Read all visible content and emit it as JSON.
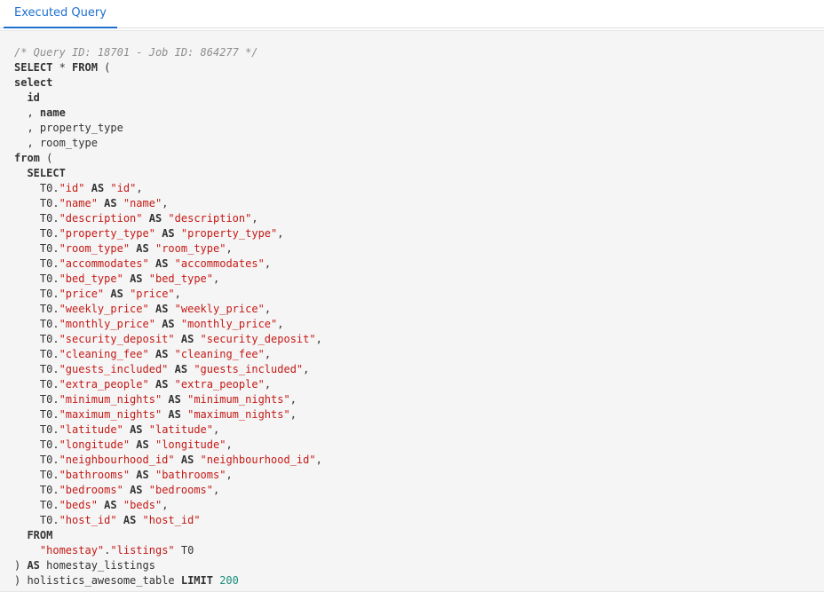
{
  "tab": {
    "label": "Executed Query"
  },
  "code": {
    "lines": [
      [
        {
          "t": "c",
          "v": "/* Query ID: 18701 - Job ID: 864277 */"
        }
      ],
      [
        {
          "t": "k",
          "v": "SELECT"
        },
        {
          "t": "p",
          "v": " * "
        },
        {
          "t": "k",
          "v": "FROM"
        },
        {
          "t": "p",
          "v": " ("
        }
      ],
      [
        {
          "t": "k",
          "v": "select"
        }
      ],
      [
        {
          "t": "p",
          "v": "  "
        },
        {
          "t": "k",
          "v": "id"
        }
      ],
      [
        {
          "t": "p",
          "v": "  , "
        },
        {
          "t": "k",
          "v": "name"
        }
      ],
      [
        {
          "t": "p",
          "v": "  , property_type"
        }
      ],
      [
        {
          "t": "p",
          "v": "  , room_type"
        }
      ],
      [
        {
          "t": "k",
          "v": "from"
        },
        {
          "t": "p",
          "v": " ("
        }
      ],
      [
        {
          "t": "p",
          "v": "  "
        },
        {
          "t": "k",
          "v": "SELECT"
        }
      ],
      [
        {
          "t": "p",
          "v": "    T0."
        },
        {
          "t": "s",
          "v": "\"id\""
        },
        {
          "t": "p",
          "v": " "
        },
        {
          "t": "k",
          "v": "AS"
        },
        {
          "t": "p",
          "v": " "
        },
        {
          "t": "s",
          "v": "\"id\""
        },
        {
          "t": "p",
          "v": ","
        }
      ],
      [
        {
          "t": "p",
          "v": "    T0."
        },
        {
          "t": "s",
          "v": "\"name\""
        },
        {
          "t": "p",
          "v": " "
        },
        {
          "t": "k",
          "v": "AS"
        },
        {
          "t": "p",
          "v": " "
        },
        {
          "t": "s",
          "v": "\"name\""
        },
        {
          "t": "p",
          "v": ","
        }
      ],
      [
        {
          "t": "p",
          "v": "    T0."
        },
        {
          "t": "s",
          "v": "\"description\""
        },
        {
          "t": "p",
          "v": " "
        },
        {
          "t": "k",
          "v": "AS"
        },
        {
          "t": "p",
          "v": " "
        },
        {
          "t": "s",
          "v": "\"description\""
        },
        {
          "t": "p",
          "v": ","
        }
      ],
      [
        {
          "t": "p",
          "v": "    T0."
        },
        {
          "t": "s",
          "v": "\"property_type\""
        },
        {
          "t": "p",
          "v": " "
        },
        {
          "t": "k",
          "v": "AS"
        },
        {
          "t": "p",
          "v": " "
        },
        {
          "t": "s",
          "v": "\"property_type\""
        },
        {
          "t": "p",
          "v": ","
        }
      ],
      [
        {
          "t": "p",
          "v": "    T0."
        },
        {
          "t": "s",
          "v": "\"room_type\""
        },
        {
          "t": "p",
          "v": " "
        },
        {
          "t": "k",
          "v": "AS"
        },
        {
          "t": "p",
          "v": " "
        },
        {
          "t": "s",
          "v": "\"room_type\""
        },
        {
          "t": "p",
          "v": ","
        }
      ],
      [
        {
          "t": "p",
          "v": "    T0."
        },
        {
          "t": "s",
          "v": "\"accommodates\""
        },
        {
          "t": "p",
          "v": " "
        },
        {
          "t": "k",
          "v": "AS"
        },
        {
          "t": "p",
          "v": " "
        },
        {
          "t": "s",
          "v": "\"accommodates\""
        },
        {
          "t": "p",
          "v": ","
        }
      ],
      [
        {
          "t": "p",
          "v": "    T0."
        },
        {
          "t": "s",
          "v": "\"bed_type\""
        },
        {
          "t": "p",
          "v": " "
        },
        {
          "t": "k",
          "v": "AS"
        },
        {
          "t": "p",
          "v": " "
        },
        {
          "t": "s",
          "v": "\"bed_type\""
        },
        {
          "t": "p",
          "v": ","
        }
      ],
      [
        {
          "t": "p",
          "v": "    T0."
        },
        {
          "t": "s",
          "v": "\"price\""
        },
        {
          "t": "p",
          "v": " "
        },
        {
          "t": "k",
          "v": "AS"
        },
        {
          "t": "p",
          "v": " "
        },
        {
          "t": "s",
          "v": "\"price\""
        },
        {
          "t": "p",
          "v": ","
        }
      ],
      [
        {
          "t": "p",
          "v": "    T0."
        },
        {
          "t": "s",
          "v": "\"weekly_price\""
        },
        {
          "t": "p",
          "v": " "
        },
        {
          "t": "k",
          "v": "AS"
        },
        {
          "t": "p",
          "v": " "
        },
        {
          "t": "s",
          "v": "\"weekly_price\""
        },
        {
          "t": "p",
          "v": ","
        }
      ],
      [
        {
          "t": "p",
          "v": "    T0."
        },
        {
          "t": "s",
          "v": "\"monthly_price\""
        },
        {
          "t": "p",
          "v": " "
        },
        {
          "t": "k",
          "v": "AS"
        },
        {
          "t": "p",
          "v": " "
        },
        {
          "t": "s",
          "v": "\"monthly_price\""
        },
        {
          "t": "p",
          "v": ","
        }
      ],
      [
        {
          "t": "p",
          "v": "    T0."
        },
        {
          "t": "s",
          "v": "\"security_deposit\""
        },
        {
          "t": "p",
          "v": " "
        },
        {
          "t": "k",
          "v": "AS"
        },
        {
          "t": "p",
          "v": " "
        },
        {
          "t": "s",
          "v": "\"security_deposit\""
        },
        {
          "t": "p",
          "v": ","
        }
      ],
      [
        {
          "t": "p",
          "v": "    T0."
        },
        {
          "t": "s",
          "v": "\"cleaning_fee\""
        },
        {
          "t": "p",
          "v": " "
        },
        {
          "t": "k",
          "v": "AS"
        },
        {
          "t": "p",
          "v": " "
        },
        {
          "t": "s",
          "v": "\"cleaning_fee\""
        },
        {
          "t": "p",
          "v": ","
        }
      ],
      [
        {
          "t": "p",
          "v": "    T0."
        },
        {
          "t": "s",
          "v": "\"guests_included\""
        },
        {
          "t": "p",
          "v": " "
        },
        {
          "t": "k",
          "v": "AS"
        },
        {
          "t": "p",
          "v": " "
        },
        {
          "t": "s",
          "v": "\"guests_included\""
        },
        {
          "t": "p",
          "v": ","
        }
      ],
      [
        {
          "t": "p",
          "v": "    T0."
        },
        {
          "t": "s",
          "v": "\"extra_people\""
        },
        {
          "t": "p",
          "v": " "
        },
        {
          "t": "k",
          "v": "AS"
        },
        {
          "t": "p",
          "v": " "
        },
        {
          "t": "s",
          "v": "\"extra_people\""
        },
        {
          "t": "p",
          "v": ","
        }
      ],
      [
        {
          "t": "p",
          "v": "    T0."
        },
        {
          "t": "s",
          "v": "\"minimum_nights\""
        },
        {
          "t": "p",
          "v": " "
        },
        {
          "t": "k",
          "v": "AS"
        },
        {
          "t": "p",
          "v": " "
        },
        {
          "t": "s",
          "v": "\"minimum_nights\""
        },
        {
          "t": "p",
          "v": ","
        }
      ],
      [
        {
          "t": "p",
          "v": "    T0."
        },
        {
          "t": "s",
          "v": "\"maximum_nights\""
        },
        {
          "t": "p",
          "v": " "
        },
        {
          "t": "k",
          "v": "AS"
        },
        {
          "t": "p",
          "v": " "
        },
        {
          "t": "s",
          "v": "\"maximum_nights\""
        },
        {
          "t": "p",
          "v": ","
        }
      ],
      [
        {
          "t": "p",
          "v": "    T0."
        },
        {
          "t": "s",
          "v": "\"latitude\""
        },
        {
          "t": "p",
          "v": " "
        },
        {
          "t": "k",
          "v": "AS"
        },
        {
          "t": "p",
          "v": " "
        },
        {
          "t": "s",
          "v": "\"latitude\""
        },
        {
          "t": "p",
          "v": ","
        }
      ],
      [
        {
          "t": "p",
          "v": "    T0."
        },
        {
          "t": "s",
          "v": "\"longitude\""
        },
        {
          "t": "p",
          "v": " "
        },
        {
          "t": "k",
          "v": "AS"
        },
        {
          "t": "p",
          "v": " "
        },
        {
          "t": "s",
          "v": "\"longitude\""
        },
        {
          "t": "p",
          "v": ","
        }
      ],
      [
        {
          "t": "p",
          "v": "    T0."
        },
        {
          "t": "s",
          "v": "\"neighbourhood_id\""
        },
        {
          "t": "p",
          "v": " "
        },
        {
          "t": "k",
          "v": "AS"
        },
        {
          "t": "p",
          "v": " "
        },
        {
          "t": "s",
          "v": "\"neighbourhood_id\""
        },
        {
          "t": "p",
          "v": ","
        }
      ],
      [
        {
          "t": "p",
          "v": "    T0."
        },
        {
          "t": "s",
          "v": "\"bathrooms\""
        },
        {
          "t": "p",
          "v": " "
        },
        {
          "t": "k",
          "v": "AS"
        },
        {
          "t": "p",
          "v": " "
        },
        {
          "t": "s",
          "v": "\"bathrooms\""
        },
        {
          "t": "p",
          "v": ","
        }
      ],
      [
        {
          "t": "p",
          "v": "    T0."
        },
        {
          "t": "s",
          "v": "\"bedrooms\""
        },
        {
          "t": "p",
          "v": " "
        },
        {
          "t": "k",
          "v": "AS"
        },
        {
          "t": "p",
          "v": " "
        },
        {
          "t": "s",
          "v": "\"bedrooms\""
        },
        {
          "t": "p",
          "v": ","
        }
      ],
      [
        {
          "t": "p",
          "v": "    T0."
        },
        {
          "t": "s",
          "v": "\"beds\""
        },
        {
          "t": "p",
          "v": " "
        },
        {
          "t": "k",
          "v": "AS"
        },
        {
          "t": "p",
          "v": " "
        },
        {
          "t": "s",
          "v": "\"beds\""
        },
        {
          "t": "p",
          "v": ","
        }
      ],
      [
        {
          "t": "p",
          "v": "    T0."
        },
        {
          "t": "s",
          "v": "\"host_id\""
        },
        {
          "t": "p",
          "v": " "
        },
        {
          "t": "k",
          "v": "AS"
        },
        {
          "t": "p",
          "v": " "
        },
        {
          "t": "s",
          "v": "\"host_id\""
        }
      ],
      [
        {
          "t": "p",
          "v": "  "
        },
        {
          "t": "k",
          "v": "FROM"
        }
      ],
      [
        {
          "t": "p",
          "v": "    "
        },
        {
          "t": "s",
          "v": "\"homestay\""
        },
        {
          "t": "p",
          "v": "."
        },
        {
          "t": "s",
          "v": "\"listings\""
        },
        {
          "t": "p",
          "v": " T0"
        }
      ],
      [
        {
          "t": "p",
          "v": ") "
        },
        {
          "t": "k",
          "v": "AS"
        },
        {
          "t": "p",
          "v": " homestay_listings"
        }
      ],
      [
        {
          "t": "p",
          "v": ") holistics_awesome_table "
        },
        {
          "t": "k",
          "v": "LIMIT"
        },
        {
          "t": "p",
          "v": " "
        },
        {
          "t": "n",
          "v": "200"
        }
      ]
    ]
  }
}
